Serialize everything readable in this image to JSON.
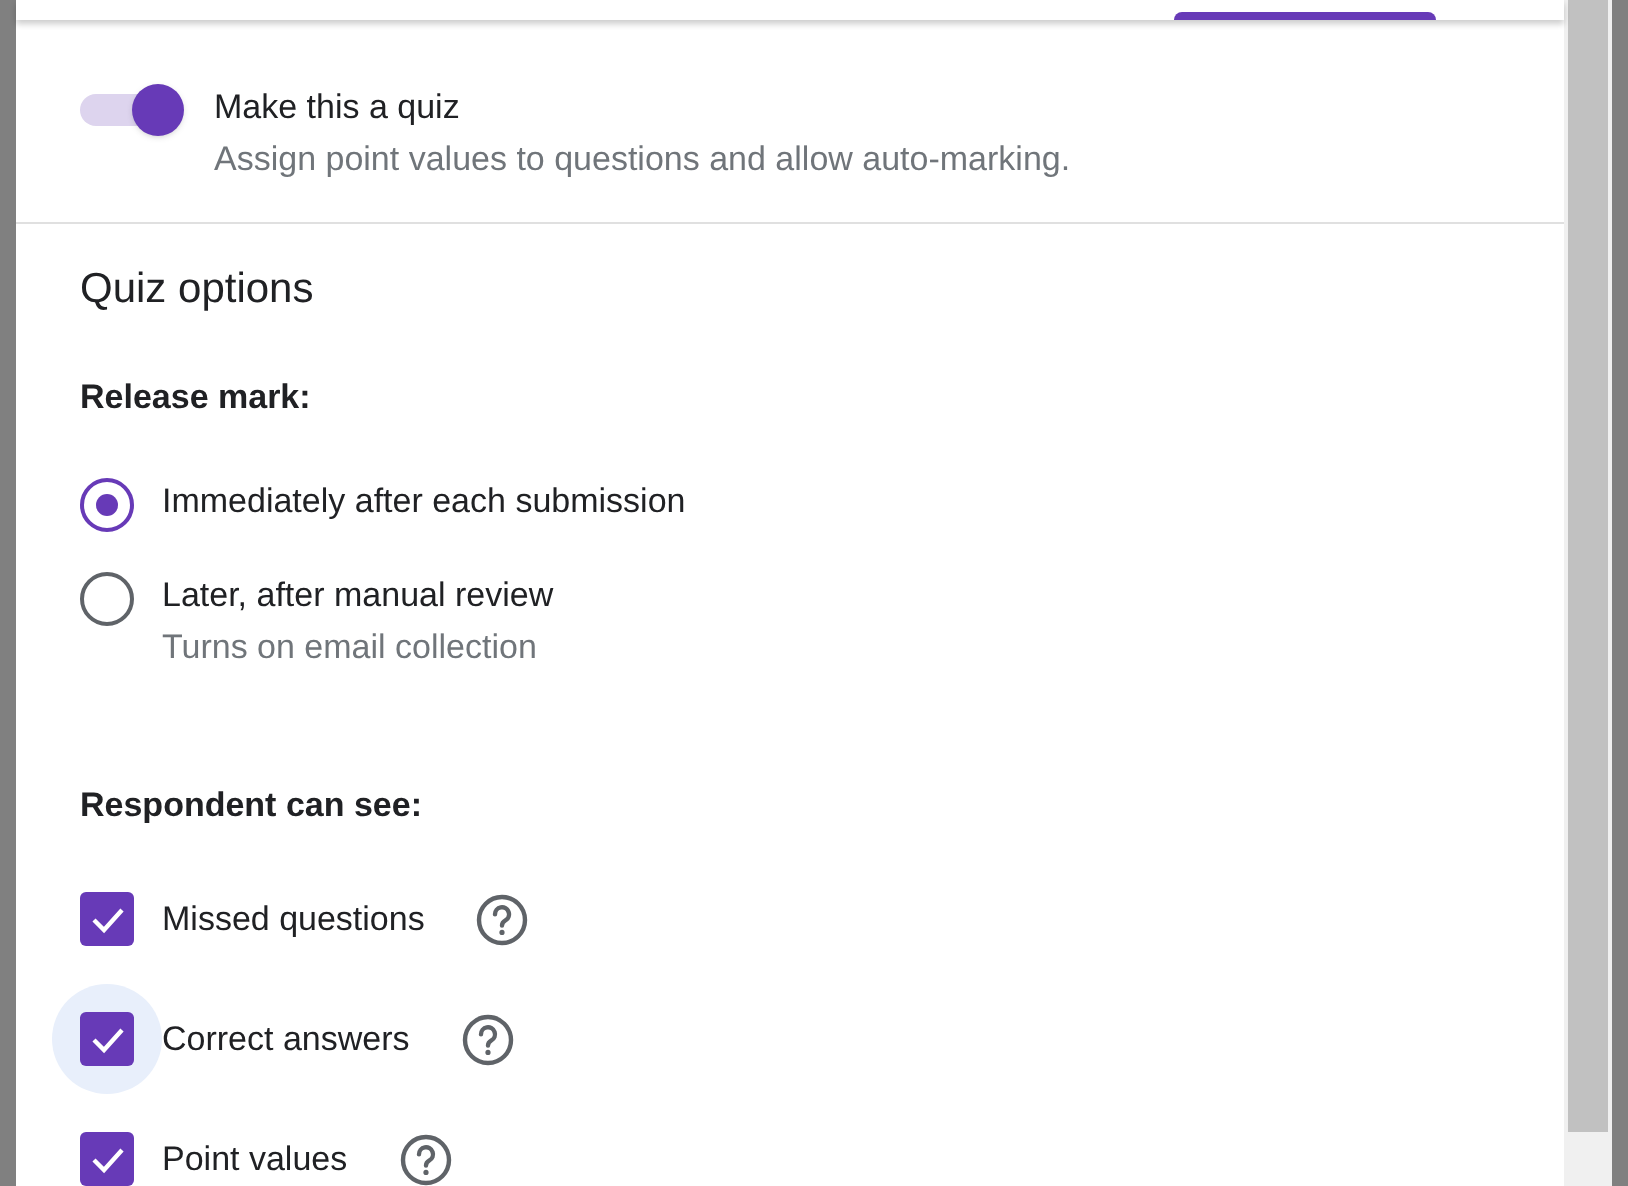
{
  "quiz_toggle": {
    "label": "Make this a quiz",
    "description": "Assign point values to questions and allow auto-marking.",
    "on": true
  },
  "section_title": "Quiz options",
  "release_mark": {
    "heading": "Release mark:",
    "options": [
      {
        "label": "Immediately after each submission",
        "selected": true
      },
      {
        "label": "Later, after manual review",
        "note": "Turns on email collection",
        "selected": false
      }
    ]
  },
  "respondent_can_see": {
    "heading": "Respondent can see:",
    "options": [
      {
        "label": "Missed questions",
        "checked": true,
        "focused": false
      },
      {
        "label": "Correct answers",
        "checked": true,
        "focused": true
      },
      {
        "label": "Point values",
        "checked": true,
        "focused": false
      }
    ]
  }
}
